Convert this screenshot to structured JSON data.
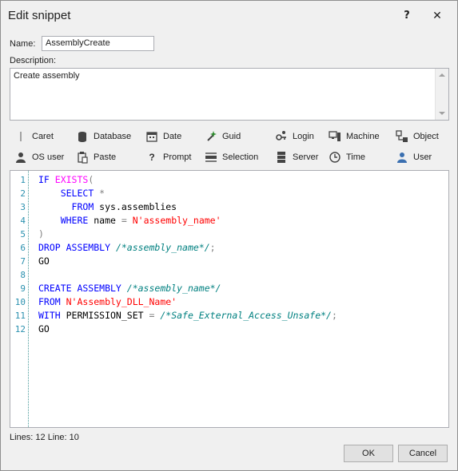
{
  "window": {
    "title": "Edit snippet",
    "help_label": "?",
    "close_label": "✕"
  },
  "form": {
    "name_label": "Name:",
    "name_value": "AssemblyCreate",
    "description_label": "Description:",
    "description_value": "Create assembly"
  },
  "toolbar": {
    "items": [
      {
        "label": "Caret",
        "icon": "caret-icon"
      },
      {
        "label": "Database",
        "icon": "database-icon"
      },
      {
        "label": "Date",
        "icon": "calendar-icon"
      },
      {
        "label": "Guid",
        "icon": "wand-icon"
      },
      {
        "label": "Login",
        "icon": "login-icon"
      },
      {
        "label": "Machine",
        "icon": "machine-icon"
      },
      {
        "label": "Object",
        "icon": "object-icon"
      },
      {
        "label": "OS user",
        "icon": "os-user-icon"
      },
      {
        "label": "Paste",
        "icon": "paste-icon"
      },
      {
        "label": "Prompt",
        "icon": "question-icon"
      },
      {
        "label": "Selection",
        "icon": "selection-icon"
      },
      {
        "label": "Server",
        "icon": "server-icon"
      },
      {
        "label": "Time",
        "icon": "clock-icon"
      },
      {
        "label": "User",
        "icon": "user-icon"
      }
    ]
  },
  "editor": {
    "line_numbers": [
      "1",
      "2",
      "3",
      "4",
      "5",
      "6",
      "7",
      "8",
      "9",
      "10",
      "11",
      "12"
    ],
    "lines": [
      [
        [
          "kw",
          "IF "
        ],
        [
          "fn",
          "EXISTS"
        ],
        [
          "op",
          "("
        ]
      ],
      [
        [
          "txt",
          "    "
        ],
        [
          "kw",
          "SELECT "
        ],
        [
          "op",
          "*"
        ]
      ],
      [
        [
          "txt",
          "      "
        ],
        [
          "kw",
          "FROM "
        ],
        [
          "txt",
          "sys.assemblies"
        ]
      ],
      [
        [
          "txt",
          "    "
        ],
        [
          "kw",
          "WHERE "
        ],
        [
          "txt",
          "name "
        ],
        [
          "op",
          "= "
        ],
        [
          "str",
          "N'assembly_name'"
        ]
      ],
      [
        [
          "op",
          ")"
        ]
      ],
      [
        [
          "kw",
          "DROP ASSEMBLY "
        ],
        [
          "cm",
          "/*assembly_name*/"
        ],
        [
          "op",
          ";"
        ]
      ],
      [
        [
          "txt",
          "GO"
        ]
      ],
      [
        [
          "txt",
          ""
        ]
      ],
      [
        [
          "kw",
          "CREATE ASSEMBLY "
        ],
        [
          "cm",
          "/*assembly_name*/"
        ]
      ],
      [
        [
          "kw",
          "FROM "
        ],
        [
          "str",
          "N'Assembly_DLL_Name'"
        ]
      ],
      [
        [
          "kw",
          "WITH "
        ],
        [
          "txt",
          "PERMISSION_SET "
        ],
        [
          "op",
          "= "
        ],
        [
          "cm",
          "/*Safe_External_Access_Unsafe*/"
        ],
        [
          "op",
          ";"
        ]
      ],
      [
        [
          "txt",
          "GO"
        ]
      ]
    ]
  },
  "status": {
    "text": "Lines: 12 Line: 10"
  },
  "buttons": {
    "ok_label": "OK",
    "cancel_label": "Cancel"
  },
  "colors": {
    "keyword": "#0000ff",
    "function": "#ff00ff",
    "string": "#ff0000",
    "comment": "#008080",
    "line_number": "#2b91af"
  }
}
